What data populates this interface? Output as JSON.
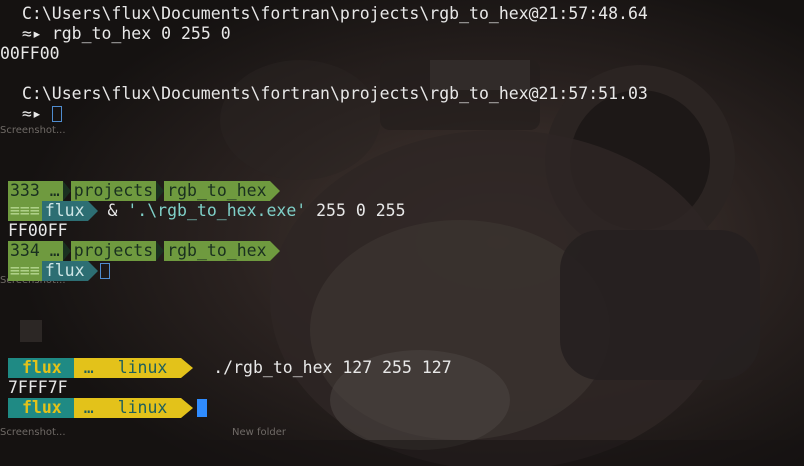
{
  "block1": {
    "path1": "C:\\Users\\flux\\Documents\\fortran\\projects\\rgb_to_hex@21:57:48.64",
    "prompt_symbol": "≈▸",
    "command1": "rgb_to_hex 0 255 0",
    "output1": "00FF00",
    "path2": "C:\\Users\\flux\\Documents\\fortran\\projects\\rgb_to_hex@21:57:51.03"
  },
  "block2": {
    "seg_num1": "333",
    "seg_ellipsis": "…",
    "seg_projects": "projects",
    "seg_dir": "rgb_to_hex",
    "seg_menu": "≡≡≡",
    "seg_user": "flux",
    "command": "& '.\\rgb_to_hex.exe' 255 0 255",
    "cmd_amp": "&",
    "cmd_string": "'.\\rgb_to_hex.exe'",
    "cmd_args": "255 0 255",
    "output": "FF00FF",
    "seg_num2": "334"
  },
  "block3": {
    "seg_user": "flux",
    "seg_ellipsis": "…",
    "seg_dir": "linux",
    "command": "./rgb_to_hex 127 255 127",
    "output": "7FFF7F"
  },
  "desktop": {
    "label1": "Screenshot...",
    "label2": "Screenshot...",
    "label3": "Screenshot...",
    "label4": "New folder"
  },
  "colors": {
    "ps_green": "#6f9a3f",
    "ps_teal": "#2d6e73",
    "zsh_teal": "#1f8a84",
    "zsh_yellow": "#e3c21a",
    "cursor_blue": "#2f8cff"
  }
}
